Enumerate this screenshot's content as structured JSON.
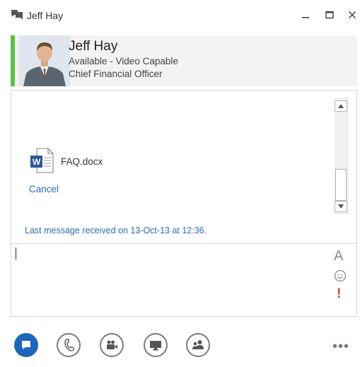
{
  "window": {
    "title": "Jeff Hay",
    "min_label": "–",
    "max_label": "☐",
    "close_label": "✕"
  },
  "contact": {
    "name": "Jeff Hay",
    "status": "Available - Video Capable",
    "job_title": "Chief Financial Officer",
    "presence_color": "#5ac244"
  },
  "conversation": {
    "file_name": "FAQ.docx",
    "file_icon": "word-document-icon",
    "cancel_label": "Cancel",
    "last_message": "Last message received on 13-Oct-13 at 12:36."
  },
  "compose": {
    "format_label": "A",
    "importance_label": "!"
  },
  "toolbar": {
    "more_label": "•••",
    "buttons": [
      "im-button",
      "call-button",
      "video-button",
      "present-button",
      "participants-button"
    ]
  },
  "colors": {
    "accent": "#1d67b9",
    "link": "#2a6cb7",
    "importance": "#d2473a"
  }
}
